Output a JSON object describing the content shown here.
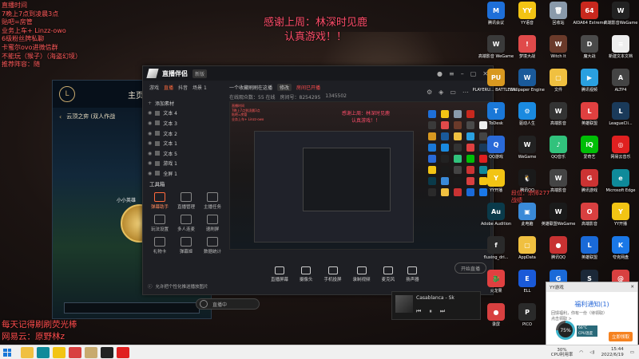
{
  "overlay": {
    "left_lines": [
      "直播时间",
      "7晚上7点到凌晨3点",
      "贴吧=房管",
      "业务上车+ Linzz-owo",
      "6级粉丝牌私聊",
      "卡蜜尔ovo进微信群",
      "不能玩（猴子）（海盗幻境）",
      "推荐阵容：随"
    ],
    "center_text": [
      "感谢上周：林深时见鹿",
      "认真游戏！！"
    ],
    "bottom_left": [
      "每天记得刷刷荧光棒",
      "网易云：原野林z"
    ]
  },
  "game_window": {
    "nav_label": "主页",
    "sub_title": "云顶之弈 (双人作战",
    "hero_name": "小小英雄"
  },
  "stream_app": {
    "title": "直播伴侣",
    "version": "新版",
    "tabs": [
      "游戏",
      "直播",
      "抖音",
      "场景 1"
    ],
    "room_title": "一个收藏刷刷在这播",
    "room_tag": "修改",
    "room_warning": "房间已开播",
    "room_info": [
      "在线观众数：55 在线",
      "房间号：8254295",
      "1345502"
    ],
    "sources": [
      "文本 4",
      "文本 3",
      "文本 2",
      "文本 1",
      "文本 5",
      "游戏 1",
      "全屏 1"
    ],
    "sources_header": "添加素材",
    "tools_label": "工具箱",
    "tools": [
      "弹幕助手",
      "直播管理",
      "主播任务",
      "玩法设置",
      "多人连麦",
      "速刷屏",
      "礼物卡",
      "弹幕姬",
      "数据统计"
    ],
    "hint": "允许把个性化推送播放图片",
    "preview_text": [
      "感谢上周：林深时见鹿",
      "认真游戏！！"
    ],
    "bottom_tools": [
      "直播屏幕",
      "摄像头",
      "手机投屏",
      "录制视频",
      "麦克风",
      "扬声器"
    ],
    "start_label": "开始直播",
    "search_label": "直播中"
  },
  "music": {
    "title": "Casablanca - Sk"
  },
  "desktop": {
    "icons": [
      {
        "label": "腾讯会议",
        "color": "#1e6fd8",
        "glyph": "M"
      },
      {
        "label": "YY语音",
        "color": "#f2c414",
        "glyph": "YY"
      },
      {
        "label": "回收站",
        "color": "#8a9aab",
        "glyph": "🗑"
      },
      {
        "label": "AIDA64 Extreme",
        "color": "#c8281e",
        "glyph": "64"
      },
      {
        "label": "高端影音WeGame",
        "color": "#222222",
        "glyph": "W"
      },
      {
        "label": "高端影音 WeGame",
        "color": "#3a3a3a",
        "glyph": "W"
      },
      {
        "label": "梦境大战",
        "color": "#e04a4a",
        "glyph": "!"
      },
      {
        "label": "Witch It",
        "color": "#6a3a2a",
        "glyph": "W"
      },
      {
        "label": "魔大战",
        "color": "#4a4a4a",
        "glyph": "D"
      },
      {
        "label": "新建文本文档",
        "color": "#eeeeee",
        "glyph": "≡"
      },
      {
        "label": "PLAYERU... BATTLEGR...",
        "color": "#d89820",
        "glyph": "PU"
      },
      {
        "label": "Wallpaper Engine",
        "color": "#1a5a9a",
        "glyph": "W"
      },
      {
        "label": "文件",
        "color": "#f0c040",
        "glyph": "▢"
      },
      {
        "label": "腾讯视频",
        "color": "#2aa0e0",
        "glyph": "▶"
      },
      {
        "label": "ALTP4",
        "color": "#444444",
        "glyph": "A"
      },
      {
        "label": "ToDesk",
        "color": "#1a78d8",
        "glyph": "T"
      },
      {
        "label": "驱动人生",
        "color": "#1a8ae0",
        "glyph": "⚙"
      },
      {
        "label": "高端影音",
        "color": "#333333",
        "glyph": "W"
      },
      {
        "label": "英雄联盟",
        "color": "#e04040",
        "glyph": "L"
      },
      {
        "label": "LeagueCli...",
        "color": "#1a3a5a",
        "glyph": "L"
      },
      {
        "label": "QQ游戏",
        "color": "#2a6ad8",
        "glyph": "Q"
      },
      {
        "label": "WeGame",
        "color": "#222222",
        "glyph": "W"
      },
      {
        "label": "QQ音乐",
        "color": "#31c27c",
        "glyph": "♪"
      },
      {
        "label": "爱奇艺",
        "color": "#00be06",
        "glyph": "iQ"
      },
      {
        "label": "网易云音乐",
        "color": "#e02020",
        "glyph": "◎"
      },
      {
        "label": "YY开播",
        "color": "#f2c414",
        "glyph": "Y"
      },
      {
        "label": "腾讯QQ",
        "color": "#1a1a1a",
        "glyph": "🐧"
      },
      {
        "label": "高端影音",
        "color": "#444444",
        "glyph": "W"
      },
      {
        "label": "腾讯游戏",
        "color": "#cc3333",
        "glyph": "G"
      },
      {
        "label": "Microsoft Edge",
        "color": "#0f8a9a",
        "glyph": "e"
      },
      {
        "label": "Adobe Audition",
        "color": "#0a3a4a",
        "glyph": "Au"
      },
      {
        "label": "此电脑",
        "color": "#3a8ad8",
        "glyph": "▣"
      },
      {
        "label": "英雄联盟WeGame",
        "color": "#1a1a1a",
        "glyph": "W"
      },
      {
        "label": "高端影音",
        "color": "#d84040",
        "glyph": "O"
      },
      {
        "label": "YY开播",
        "color": "#f2c414",
        "glyph": "Y"
      },
      {
        "label": "fluxing_dri...",
        "color": "#2a2a2a",
        "glyph": "f"
      },
      {
        "label": "AppData",
        "color": "#f0c040",
        "glyph": "▢"
      },
      {
        "label": "腾讯QQ",
        "color": "#c83232",
        "glyph": "●"
      },
      {
        "label": "英雄联盟",
        "color": "#1a6ad8",
        "glyph": "L"
      },
      {
        "label": "夸克网盘",
        "color": "#1a78e8",
        "glyph": "K"
      },
      {
        "label": "火龙果",
        "color": "#e04040",
        "glyph": "🐉"
      },
      {
        "label": "ELL",
        "color": "#1a5ad8",
        "glyph": "E"
      },
      {
        "label": "腾讯广告",
        "color": "#1a6ad8",
        "glyph": "G"
      },
      {
        "label": "Steam",
        "color": "#1b2838",
        "glyph": "S"
      },
      {
        "label": "网易邮箱",
        "color": "#d84040",
        "glyph": "@"
      },
      {
        "label": "录屏",
        "color": "#d84040",
        "glyph": "●"
      },
      {
        "label": "PICO",
        "color": "#2a2a2a",
        "glyph": "P"
      },
      {
        "label": "腾讯游戏",
        "color": "#c83232",
        "glyph": "G"
      }
    ],
    "red_text": [
      "段位：宗师277",
      "战绩"
    ]
  },
  "notification": {
    "header": "YY游戏",
    "title": "福利通知(1)",
    "body": [
      "回馈福利，你有一份（待领取）",
      "点击领取 >"
    ],
    "button": "立即领取"
  },
  "cpu": {
    "percent": "75%",
    "label_line1": "66°C",
    "label_line2": "CPU温度"
  },
  "taskbar": {
    "apps": [
      {
        "name": "file-explorer",
        "color": "#f0c040"
      },
      {
        "name": "edge",
        "color": "#0f8a9a"
      },
      {
        "name": "yy",
        "color": "#f2c414"
      },
      {
        "name": "wegame",
        "color": "#d84040"
      },
      {
        "name": "league",
        "color": "#c8aa6e"
      },
      {
        "name": "stream",
        "color": "#222222"
      },
      {
        "name": "music",
        "color": "#e02020"
      }
    ],
    "cpu_line1": "30%",
    "cpu_line2": "CPU利用率",
    "time": "15:44",
    "date": "2022/6/19"
  }
}
